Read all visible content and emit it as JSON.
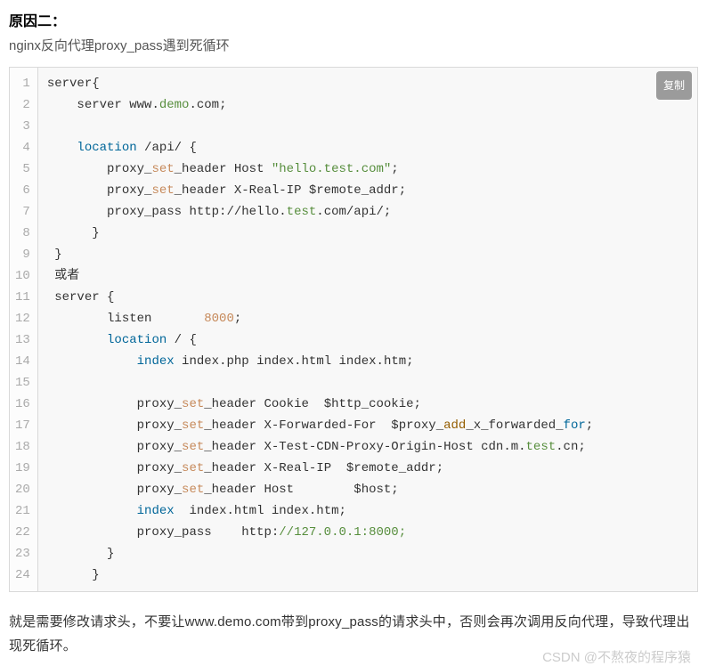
{
  "heading": "原因二：",
  "subtext": "nginx反向代理proxy_pass遇到死循环",
  "copy_label": "复制",
  "code": {
    "lines": [
      {
        "n": "1",
        "segs": [
          {
            "t": "server{",
            "c": ""
          }
        ]
      },
      {
        "n": "2",
        "segs": [
          {
            "t": "    server www",
            "c": ""
          },
          {
            "t": ".",
            "c": ""
          },
          {
            "t": "demo",
            "c": "tok-name"
          },
          {
            "t": ".",
            "c": ""
          },
          {
            "t": "com;",
            "c": ""
          }
        ]
      },
      {
        "n": "3",
        "segs": [
          {
            "t": " ",
            "c": ""
          }
        ]
      },
      {
        "n": "4",
        "segs": [
          {
            "t": "    ",
            "c": ""
          },
          {
            "t": "location",
            "c": "tok-kw"
          },
          {
            "t": " /api/ {",
            "c": ""
          }
        ]
      },
      {
        "n": "5",
        "segs": [
          {
            "t": "        proxy_",
            "c": ""
          },
          {
            "t": "set",
            "c": "tok-builtin"
          },
          {
            "t": "_header Host ",
            "c": ""
          },
          {
            "t": "\"hello.test.com\"",
            "c": "tok-str"
          },
          {
            "t": ";",
            "c": ""
          }
        ]
      },
      {
        "n": "6",
        "segs": [
          {
            "t": "        proxy_",
            "c": ""
          },
          {
            "t": "set",
            "c": "tok-builtin"
          },
          {
            "t": "_header X-Real-IP $remote_addr;",
            "c": ""
          }
        ]
      },
      {
        "n": "7",
        "segs": [
          {
            "t": "        proxy_pass http://hello",
            "c": ""
          },
          {
            "t": ".",
            "c": ""
          },
          {
            "t": "test",
            "c": "tok-name"
          },
          {
            "t": ".",
            "c": ""
          },
          {
            "t": "com/api/;",
            "c": ""
          }
        ]
      },
      {
        "n": "8",
        "segs": [
          {
            "t": "      }",
            "c": ""
          }
        ]
      },
      {
        "n": "9",
        "segs": [
          {
            "t": " }",
            "c": ""
          }
        ]
      },
      {
        "n": "10",
        "segs": [
          {
            "t": " 或者",
            "c": ""
          }
        ]
      },
      {
        "n": "11",
        "segs": [
          {
            "t": " server {",
            "c": ""
          }
        ]
      },
      {
        "n": "12",
        "segs": [
          {
            "t": "        listen       ",
            "c": ""
          },
          {
            "t": "8000",
            "c": "tok-num"
          },
          {
            "t": ";",
            "c": ""
          }
        ]
      },
      {
        "n": "13",
        "segs": [
          {
            "t": "        ",
            "c": ""
          },
          {
            "t": "location",
            "c": "tok-kw"
          },
          {
            "t": " / {",
            "c": ""
          }
        ]
      },
      {
        "n": "14",
        "segs": [
          {
            "t": "            ",
            "c": ""
          },
          {
            "t": "index",
            "c": "tok-kw"
          },
          {
            "t": " index",
            "c": ""
          },
          {
            "t": ".",
            "c": ""
          },
          {
            "t": "php index",
            "c": ""
          },
          {
            "t": ".",
            "c": ""
          },
          {
            "t": "html index",
            "c": ""
          },
          {
            "t": ".",
            "c": ""
          },
          {
            "t": "htm;",
            "c": ""
          }
        ]
      },
      {
        "n": "15",
        "segs": [
          {
            "t": " ",
            "c": ""
          }
        ]
      },
      {
        "n": "16",
        "segs": [
          {
            "t": "            proxy_",
            "c": ""
          },
          {
            "t": "set",
            "c": "tok-builtin"
          },
          {
            "t": "_header Cookie  $http_cookie;",
            "c": ""
          }
        ]
      },
      {
        "n": "17",
        "segs": [
          {
            "t": "            proxy_",
            "c": ""
          },
          {
            "t": "set",
            "c": "tok-builtin"
          },
          {
            "t": "_header X-Forwarded-For  $proxy_",
            "c": ""
          },
          {
            "t": "add",
            "c": "tok-brown"
          },
          {
            "t": "_x_forwarded_",
            "c": ""
          },
          {
            "t": "for",
            "c": "tok-kw"
          },
          {
            "t": ";",
            "c": ""
          }
        ]
      },
      {
        "n": "18",
        "segs": [
          {
            "t": "            proxy_",
            "c": ""
          },
          {
            "t": "set",
            "c": "tok-builtin"
          },
          {
            "t": "_header X-Test-CDN-Proxy-Origin-Host cdn.m.",
            "c": ""
          },
          {
            "t": "test",
            "c": "tok-name"
          },
          {
            "t": ".cn;",
            "c": ""
          }
        ]
      },
      {
        "n": "19",
        "segs": [
          {
            "t": "            proxy_",
            "c": ""
          },
          {
            "t": "set",
            "c": "tok-builtin"
          },
          {
            "t": "_header X-Real-IP  $remote_addr;",
            "c": ""
          }
        ]
      },
      {
        "n": "20",
        "segs": [
          {
            "t": "            proxy_",
            "c": ""
          },
          {
            "t": "set",
            "c": "tok-builtin"
          },
          {
            "t": "_header Host        $host;",
            "c": ""
          }
        ]
      },
      {
        "n": "21",
        "segs": [
          {
            "t": "            ",
            "c": ""
          },
          {
            "t": "index",
            "c": "tok-kw"
          },
          {
            "t": "  index",
            "c": ""
          },
          {
            "t": ".",
            "c": ""
          },
          {
            "t": "html index",
            "c": ""
          },
          {
            "t": ".",
            "c": ""
          },
          {
            "t": "htm;",
            "c": ""
          }
        ]
      },
      {
        "n": "22",
        "segs": [
          {
            "t": "            proxy_pass    http:",
            "c": ""
          },
          {
            "t": "//127.0.0.1:8000;",
            "c": "tok-str"
          }
        ]
      },
      {
        "n": "23",
        "segs": [
          {
            "t": "        }",
            "c": ""
          }
        ]
      },
      {
        "n": "24",
        "segs": [
          {
            "t": "      }",
            "c": ""
          }
        ]
      }
    ]
  },
  "footer": "就是需要修改请求头，不要让www.demo.com带到proxy_pass的请求头中，否则会再次调用反向代理，导致代理出现死循环。",
  "watermark": "CSDN @不熬夜的程序猿"
}
